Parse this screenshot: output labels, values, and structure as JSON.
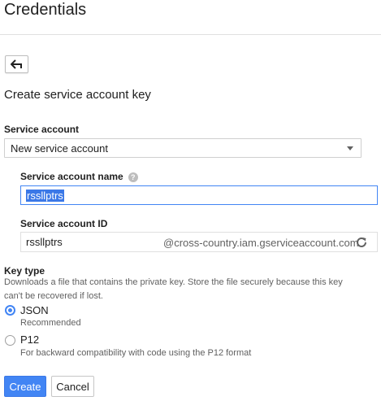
{
  "header": {
    "title": "Credentials"
  },
  "back_button": {
    "icon": "back-arrow-icon"
  },
  "form": {
    "title": "Create service account key",
    "service_account": {
      "label": "Service account",
      "selected": "New service account"
    },
    "service_account_name": {
      "label": "Service account name",
      "value": "rssllptrs",
      "help_icon": "?"
    },
    "service_account_id": {
      "label": "Service account ID",
      "value": "rssllptrs",
      "suffix": "@cross-country.iam.gserviceaccount.com",
      "refresh_icon": "refresh-icon"
    },
    "key_type": {
      "label": "Key type",
      "description_line1": "Downloads a file that contains the private key. Store the file securely because this key",
      "description_line2": "can't be recovered if lost.",
      "options": [
        {
          "label": "JSON",
          "description": "Recommended",
          "checked": true
        },
        {
          "label": "P12",
          "description": "For backward compatibility with code using the P12 format",
          "checked": false
        }
      ]
    },
    "actions": {
      "create_label": "Create",
      "cancel_label": "Cancel"
    }
  },
  "colors": {
    "accent": "#4285f4",
    "divider": "#e0e0e0"
  }
}
